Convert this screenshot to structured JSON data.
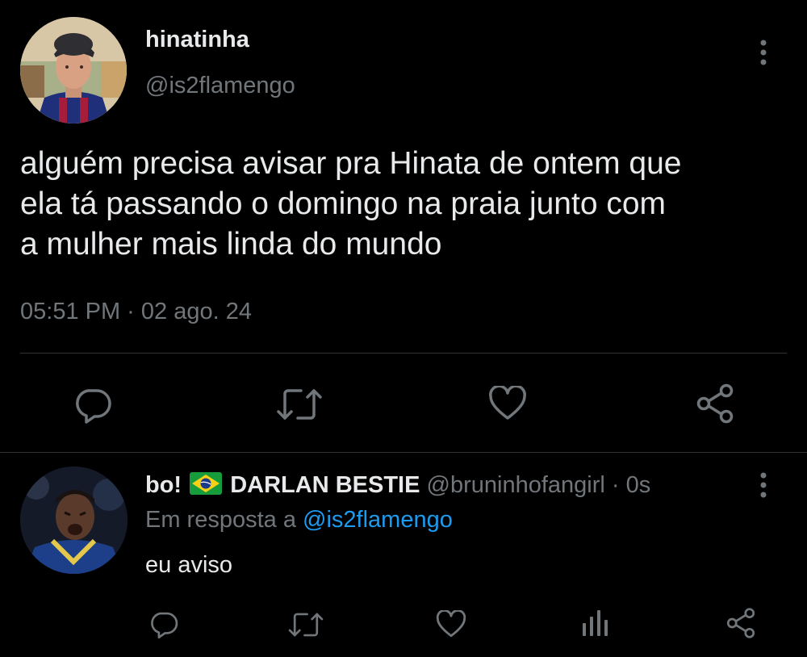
{
  "main_tweet": {
    "display_name": "hinatinha",
    "handle": "@is2flamengo",
    "text_lines": [
      "alguém precisa avisar pra Hinata de ontem que",
      "ela tá passando o domingo na praia junto com",
      "a mulher mais linda do mundo"
    ],
    "timestamp": "05:51 PM · 02 ago. 24",
    "actions": [
      "reply-icon",
      "retweet-icon",
      "like-icon",
      "share-icon"
    ]
  },
  "reply_tweet": {
    "display_name_prefix": "bo!",
    "flag": "🇧🇷",
    "display_name_suffix": "DARLAN BESTIE",
    "handle": "@bruninhofangirl",
    "separator": "·",
    "time": "0s",
    "replying_prefix": "Em resposta a",
    "replying_to": "@is2flamengo",
    "text": "eu aviso",
    "actions": [
      "reply-icon",
      "retweet-icon",
      "like-icon",
      "analytics-icon",
      "share-icon"
    ]
  },
  "colors": {
    "background": "#000000",
    "text": "#e7e9ea",
    "muted": "#71767b",
    "link": "#1d9bf0",
    "divider": "#2f3336"
  }
}
